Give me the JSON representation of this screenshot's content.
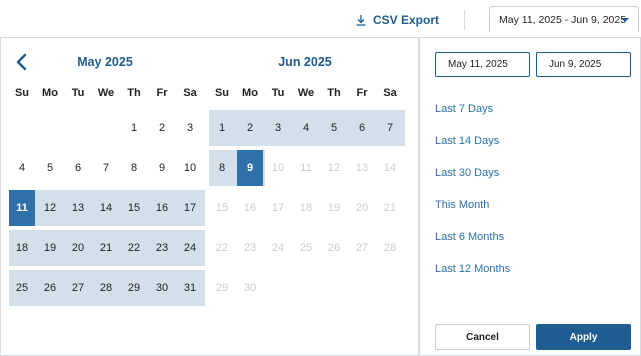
{
  "toolbar": {
    "csv_export_label": "CSV Export",
    "range_value": "May 11, 2025 - Jun 9, 2025"
  },
  "calendar": {
    "weekdays": [
      "Su",
      "Mo",
      "Tu",
      "We",
      "Th",
      "Fr",
      "Sa"
    ],
    "months": [
      {
        "title": "May 2025",
        "weeks": [
          [
            "",
            "",
            "",
            "",
            "1",
            "2",
            "3"
          ],
          [
            "4",
            "5",
            "6",
            "7",
            "8",
            "9",
            "10"
          ],
          [
            "11",
            "12",
            "13",
            "14",
            "15",
            "16",
            "17"
          ],
          [
            "18",
            "19",
            "20",
            "21",
            "22",
            "23",
            "24"
          ],
          [
            "25",
            "26",
            "27",
            "28",
            "29",
            "30",
            "31"
          ]
        ]
      },
      {
        "title": "Jun 2025",
        "weeks": [
          [
            "1",
            "2",
            "3",
            "4",
            "5",
            "6",
            "7"
          ],
          [
            "8",
            "9",
            "10",
            "11",
            "12",
            "13",
            "14"
          ],
          [
            "15",
            "16",
            "17",
            "18",
            "19",
            "20",
            "21"
          ],
          [
            "22",
            "23",
            "24",
            "25",
            "26",
            "27",
            "28"
          ],
          [
            "29",
            "30",
            "",
            "",
            "",
            "",
            ""
          ]
        ]
      }
    ],
    "selected_start": "May 11, 2025",
    "selected_end": "Jun 9, 2025"
  },
  "inputs": {
    "start_value": "May 11, 2025",
    "end_value": "Jun 9, 2025"
  },
  "presets": [
    "Last 7 Days",
    "Last 14 Days",
    "Last 30 Days",
    "This Month",
    "Last 6 Months",
    "Last 12 Months"
  ],
  "actions": {
    "cancel_label": "Cancel",
    "apply_label": "Apply"
  },
  "colors": {
    "accent": "#1d5b8c",
    "selected_day": "#2e70a8",
    "range_fill": "#d3e0ea",
    "disabled_text": "#c8cdd2"
  },
  "icons": {
    "download": "download-icon",
    "prev_month": "chevron-left-icon",
    "dropdown": "caret-down-icon"
  }
}
